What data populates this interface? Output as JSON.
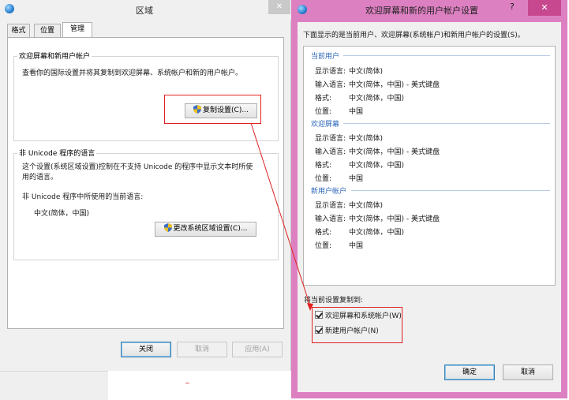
{
  "region_window": {
    "title": "区域",
    "close_glyph": "✕",
    "tabs": [
      "格式",
      "位置",
      "管理"
    ],
    "welcome_group": {
      "title": "欢迎屏幕和新用户帐户",
      "description": "查看你的国际设置并将其复制到欢迎屏幕、系统帐户和新的用户帐户。",
      "copy_button": "复制设置(C)..."
    },
    "unicode_group": {
      "title": "非 Unicode 程序的语言",
      "description_line1": "这个设置(系统区域设置)控制在不支持 Unicode 的程序中显示文本时所使",
      "description_line2": "用的语言。",
      "current_label": "非 Unicode 程序中所使用的当前语言:",
      "current_value": "中文(简体，中国)",
      "change_button": "更改系统区域设置(C)..."
    },
    "footer": {
      "close": "关闭",
      "cancel": "取消",
      "apply": "应用(A)"
    }
  },
  "copy_window": {
    "title": "欢迎屏幕和新的用户帐户设置",
    "help_glyph": "?",
    "close_glyph": "✕",
    "intro": "下面显示的是当前用户、欢迎屏幕(系统帐户)和新用户帐户的设置(S)。",
    "sections": [
      {
        "heading": "当前用户",
        "rows": [
          {
            "label": "显示语言:",
            "value": "中文(简体)"
          },
          {
            "label": "输入语言:",
            "value": "中文(简体，中国) - 美式键盘"
          },
          {
            "label": "格式:",
            "value": "中文(简体，中国)"
          },
          {
            "label": "位置:",
            "value": "中国"
          }
        ]
      },
      {
        "heading": "欢迎屏幕",
        "rows": [
          {
            "label": "显示语言:",
            "value": "中文(简体)"
          },
          {
            "label": "输入语言:",
            "value": "中文(简体，中国) - 美式键盘"
          },
          {
            "label": "格式:",
            "value": "中文(简体，中国)"
          },
          {
            "label": "位置:",
            "value": "中国"
          }
        ]
      },
      {
        "heading": "新用户帐户",
        "rows": [
          {
            "label": "显示语言:",
            "value": "中文(简体)"
          },
          {
            "label": "输入语言:",
            "value": "中文(简体，中国) - 美式键盘"
          },
          {
            "label": "格式:",
            "value": "中文(简体，中国)"
          },
          {
            "label": "位置:",
            "value": "中国"
          }
        ]
      }
    ],
    "copy_to_label": "将当前设置复制到:",
    "checkboxes": [
      {
        "label": "欢迎屏幕和系统帐户(W)",
        "checked": true
      },
      {
        "label": "新建用户帐户(N)",
        "checked": true
      }
    ],
    "ok": "确定",
    "cancel": "取消"
  },
  "colors": {
    "highlight": "#e02020",
    "window_frame": "#dd80c2",
    "section_heading": "#2b66b8"
  }
}
